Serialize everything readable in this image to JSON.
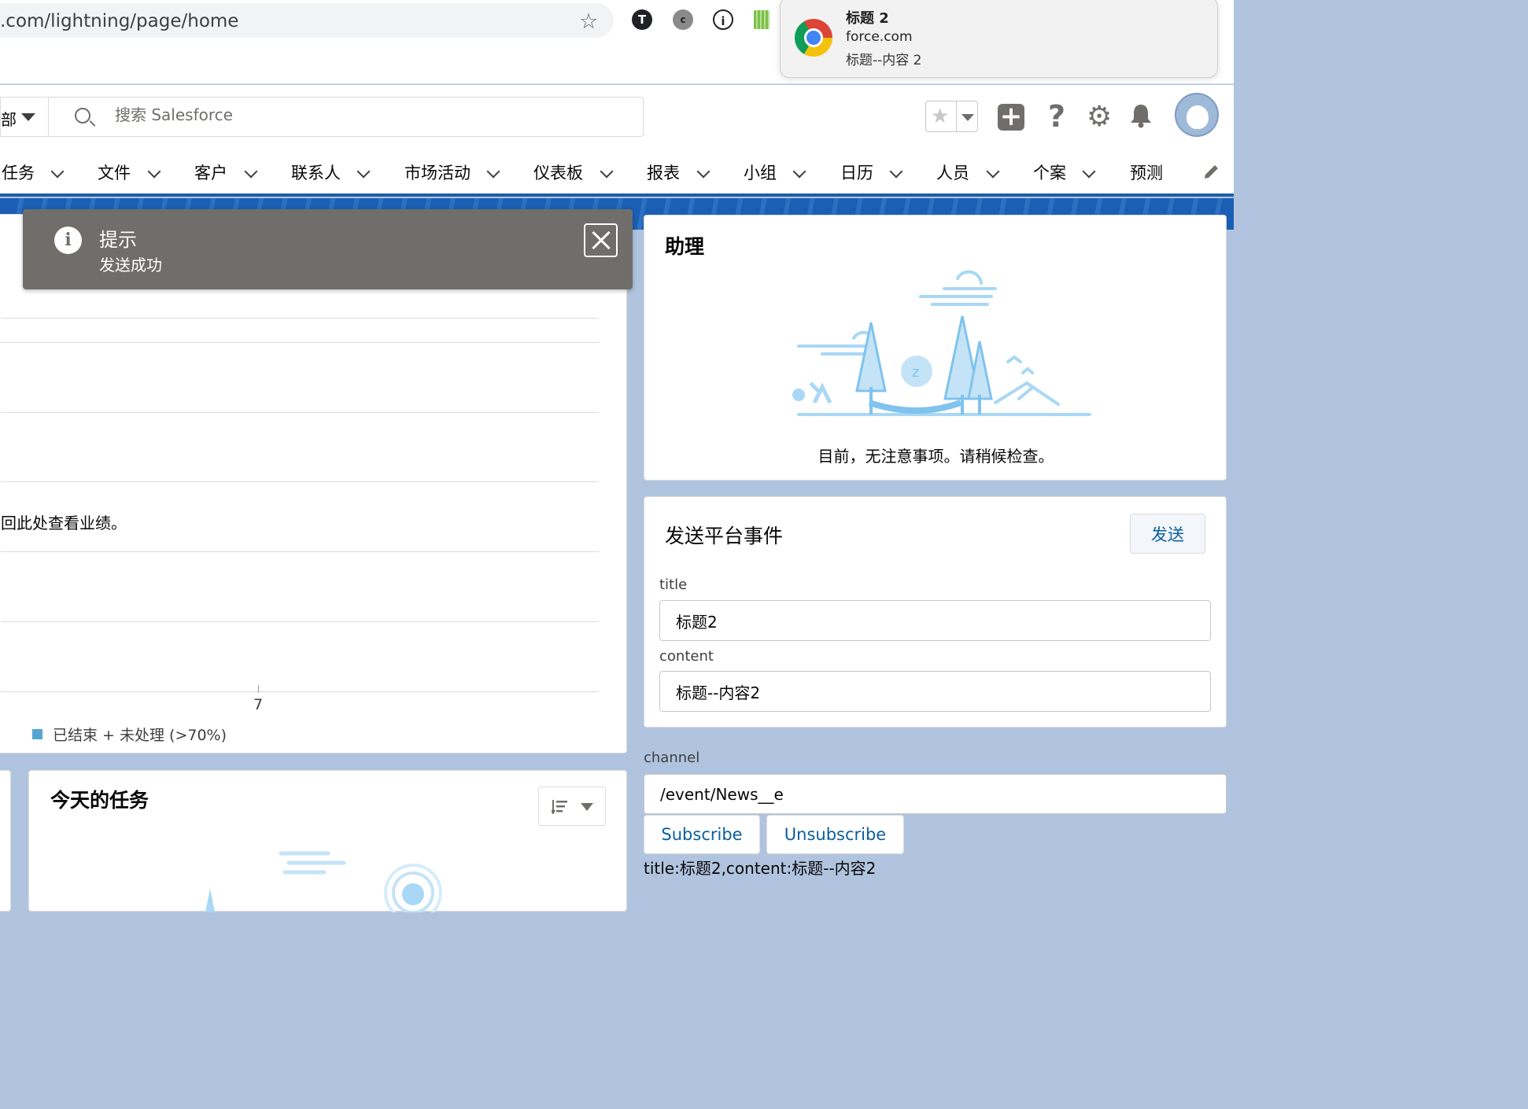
{
  "browser": {
    "url": ".com/lightning/page/home",
    "bookmark_star": "☆",
    "extensions": [
      "T",
      "c",
      "i"
    ]
  },
  "notification": {
    "title": "标题 2",
    "site": "force.com",
    "body": "标题--内容 2"
  },
  "header": {
    "search_scope": "部",
    "search_placeholder": "搜索 Salesforce",
    "fav_star": "★",
    "add_symbol": "+",
    "help_symbol": "?",
    "gear_symbol": "⚙"
  },
  "nav": {
    "items": [
      {
        "label": "任务"
      },
      {
        "label": "文件"
      },
      {
        "label": "客户"
      },
      {
        "label": "联系人"
      },
      {
        "label": "市场活动"
      },
      {
        "label": "仪表板"
      },
      {
        "label": "报表"
      },
      {
        "label": "小组"
      },
      {
        "label": "日历"
      },
      {
        "label": "人员"
      },
      {
        "label": "个案"
      },
      {
        "label": "预测"
      }
    ]
  },
  "toast": {
    "icon": "i",
    "title": "提示",
    "message": "发送成功"
  },
  "performance": {
    "message": "回此处查看业绩。",
    "tick_label": "7",
    "legend_label": "已结束 + 未处理 (>70%)",
    "legend_color": "#54a5d0"
  },
  "tasks": {
    "title": "今天的任务"
  },
  "assistant": {
    "title": "助理",
    "message": "目前，无注意事项。请稍候检查。"
  },
  "platform_event": {
    "title": "发送平台事件",
    "send_label": "发送",
    "title_label": "title",
    "title_value": "标题2",
    "content_label": "content",
    "content_value": "标题--内容2"
  },
  "channel": {
    "label": "channel",
    "value": "/event/News__e",
    "subscribe_label": "Subscribe",
    "unsubscribe_label": "Unsubscribe",
    "result": "title:标题2,content:标题--内容2"
  },
  "colors": {
    "brand_blue": "#1f5cad",
    "link_blue": "#0a5e9e",
    "toast_gray": "#706e6b",
    "page_bg": "#b0c4df"
  }
}
